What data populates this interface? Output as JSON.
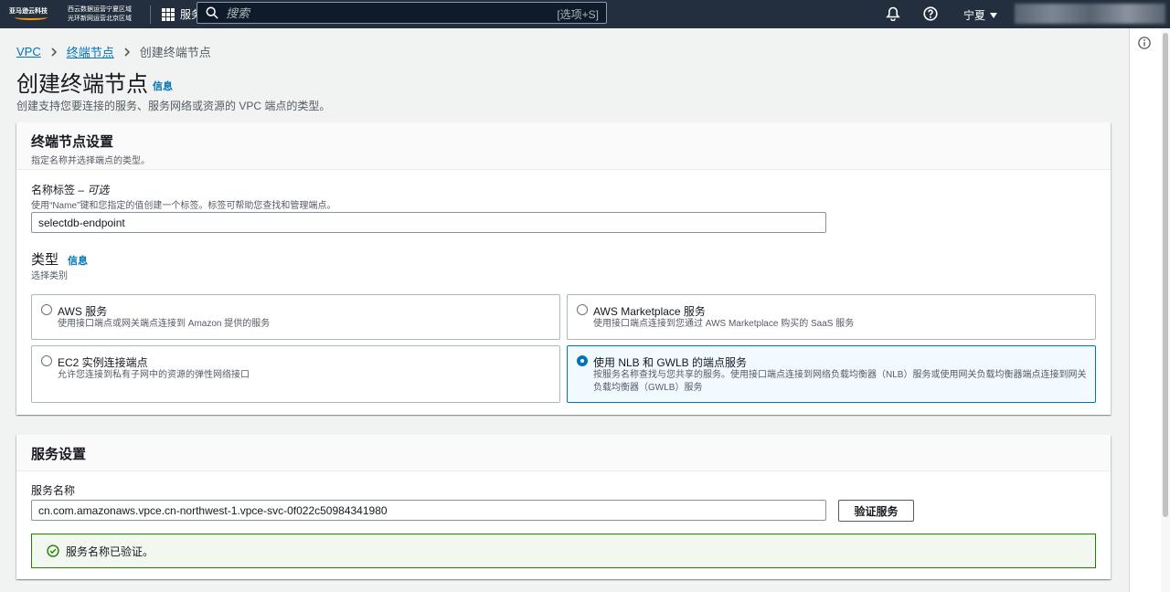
{
  "topnav": {
    "logo_text": "亚马逊云科技",
    "region_note_line1": "西云数据运营宁夏区域",
    "region_note_line2": "光环新网运营北京区域",
    "services_label": "服务",
    "search_placeholder": "搜索",
    "search_shortcut": "[选项+S]",
    "region": "宁夏"
  },
  "breadcrumb": {
    "items": [
      "VPC",
      "终端节点",
      "创建终端节点"
    ]
  },
  "page": {
    "title": "创建终端节点",
    "info": "信息",
    "description": "创建支持您要连接的服务、服务网络或资源的 VPC 端点的类型。"
  },
  "endpoint_settings": {
    "heading": "终端节点设置",
    "subheading": "指定名称并选择端点的类型。",
    "name_label": "名称标签 – ",
    "name_optional": "可选",
    "name_desc": "使用“Name”键和您指定的值创建一个标签。标签可帮助您查找和管理端点。",
    "name_value": "selectdb-endpoint",
    "type_label": "类型",
    "type_info": "信息",
    "type_desc": "选择类别",
    "types": [
      {
        "title": "AWS 服务",
        "desc": "使用接口端点或网关端点连接到 Amazon 提供的服务",
        "selected": false
      },
      {
        "title": "AWS Marketplace 服务",
        "desc": "使用接口端点连接到您通过 AWS Marketplace 购买的 SaaS 服务",
        "selected": false
      },
      {
        "title": "EC2 实例连接端点",
        "desc": "允许您连接到私有子网中的资源的弹性网络接口",
        "selected": false
      },
      {
        "title": "使用 NLB 和 GWLB 的端点服务",
        "desc": "按服务名称查找与您共享的服务。使用接口端点连接到网络负载均衡器（NLB）服务或使用网关负载均衡器端点连接到网关负载均衡器（GWLB）服务",
        "selected": true
      }
    ]
  },
  "service_settings": {
    "heading": "服务设置",
    "name_label": "服务名称",
    "name_value": "cn.com.amazonaws.vpce.cn-northwest-1.vpce-svc-0f022c50984341980",
    "verify_button": "验证服务",
    "success_message": "服务名称已验证。"
  },
  "colors": {
    "nav_bg": "#232f3e",
    "link": "#0073bb",
    "success": "#1d8102",
    "accent": "#ff9900"
  }
}
